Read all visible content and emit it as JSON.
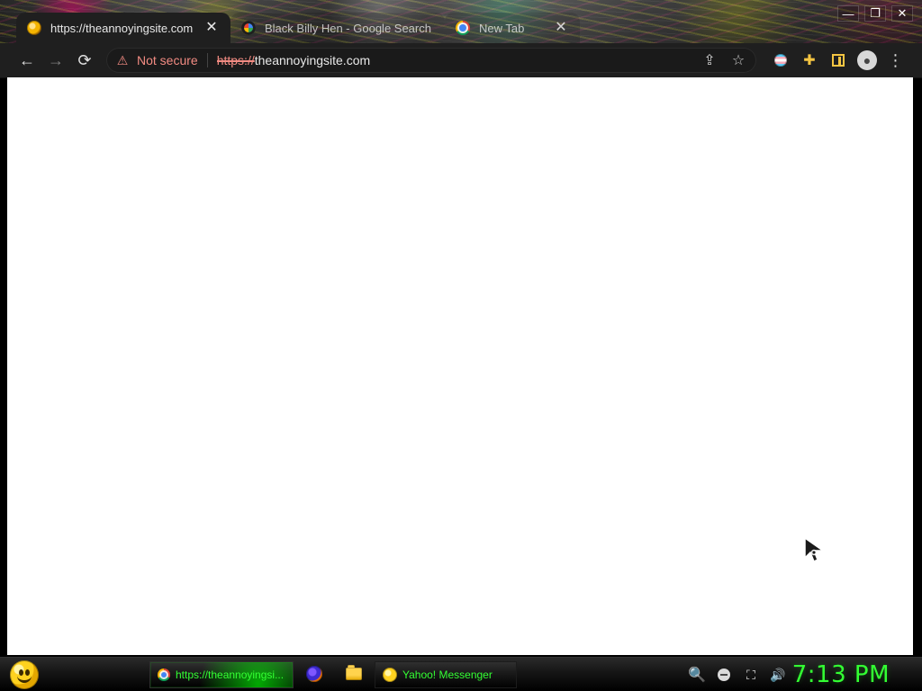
{
  "browser": {
    "tabs": [
      {
        "title": "https://theannoyingsite.com",
        "favicon": "annoying-site-icon",
        "active": true,
        "close_glyph": "✕"
      },
      {
        "title": "Black Billy Hen - Google Search",
        "favicon": "google-icon",
        "active": false
      },
      {
        "title": "New Tab",
        "favicon": "chrome-icon",
        "active": false,
        "close_glyph": "✕"
      }
    ],
    "window_controls": [
      {
        "name": "minimize",
        "glyph": "—"
      },
      {
        "name": "maximize",
        "glyph": "❐"
      },
      {
        "name": "close",
        "glyph": "✕"
      }
    ],
    "toolbar": {
      "back_glyph": "←",
      "forward_glyph": "→",
      "reload_glyph": "⟳",
      "security_label": "Not secure",
      "url_scheme": "https://",
      "url_host": "theannoyingsite.com",
      "share_glyph": "⇪",
      "bookmark_glyph": "☆",
      "puzzle_glyph": "✚",
      "avatar_glyph": "●",
      "menu_glyph": "⋮"
    }
  },
  "taskbar": {
    "tasks": [
      {
        "label": "https://theannoyingsi...",
        "icon": "chrome-icon",
        "active": true
      },
      {
        "label": "Yahoo! Messenger",
        "icon": "yahoo-messenger-icon",
        "active": false
      }
    ],
    "quick_launch": [
      {
        "name": "firefox",
        "icon": "firefox-icon"
      },
      {
        "name": "files",
        "icon": "folder-icon"
      }
    ],
    "tray": [
      {
        "name": "search",
        "icon": "search-icon",
        "glyph": "🔍"
      },
      {
        "name": "status",
        "icon": "minus-circle-icon"
      },
      {
        "name": "network",
        "icon": "network-icon",
        "glyph": "⛶"
      },
      {
        "name": "volume",
        "icon": "speaker-icon",
        "glyph": "🔊"
      }
    ],
    "clock": "7:13 PM"
  },
  "colors": {
    "clock_green": "#33ff33",
    "warning_red": "#f28b82",
    "chrome_dark": "#1f1f1f"
  }
}
